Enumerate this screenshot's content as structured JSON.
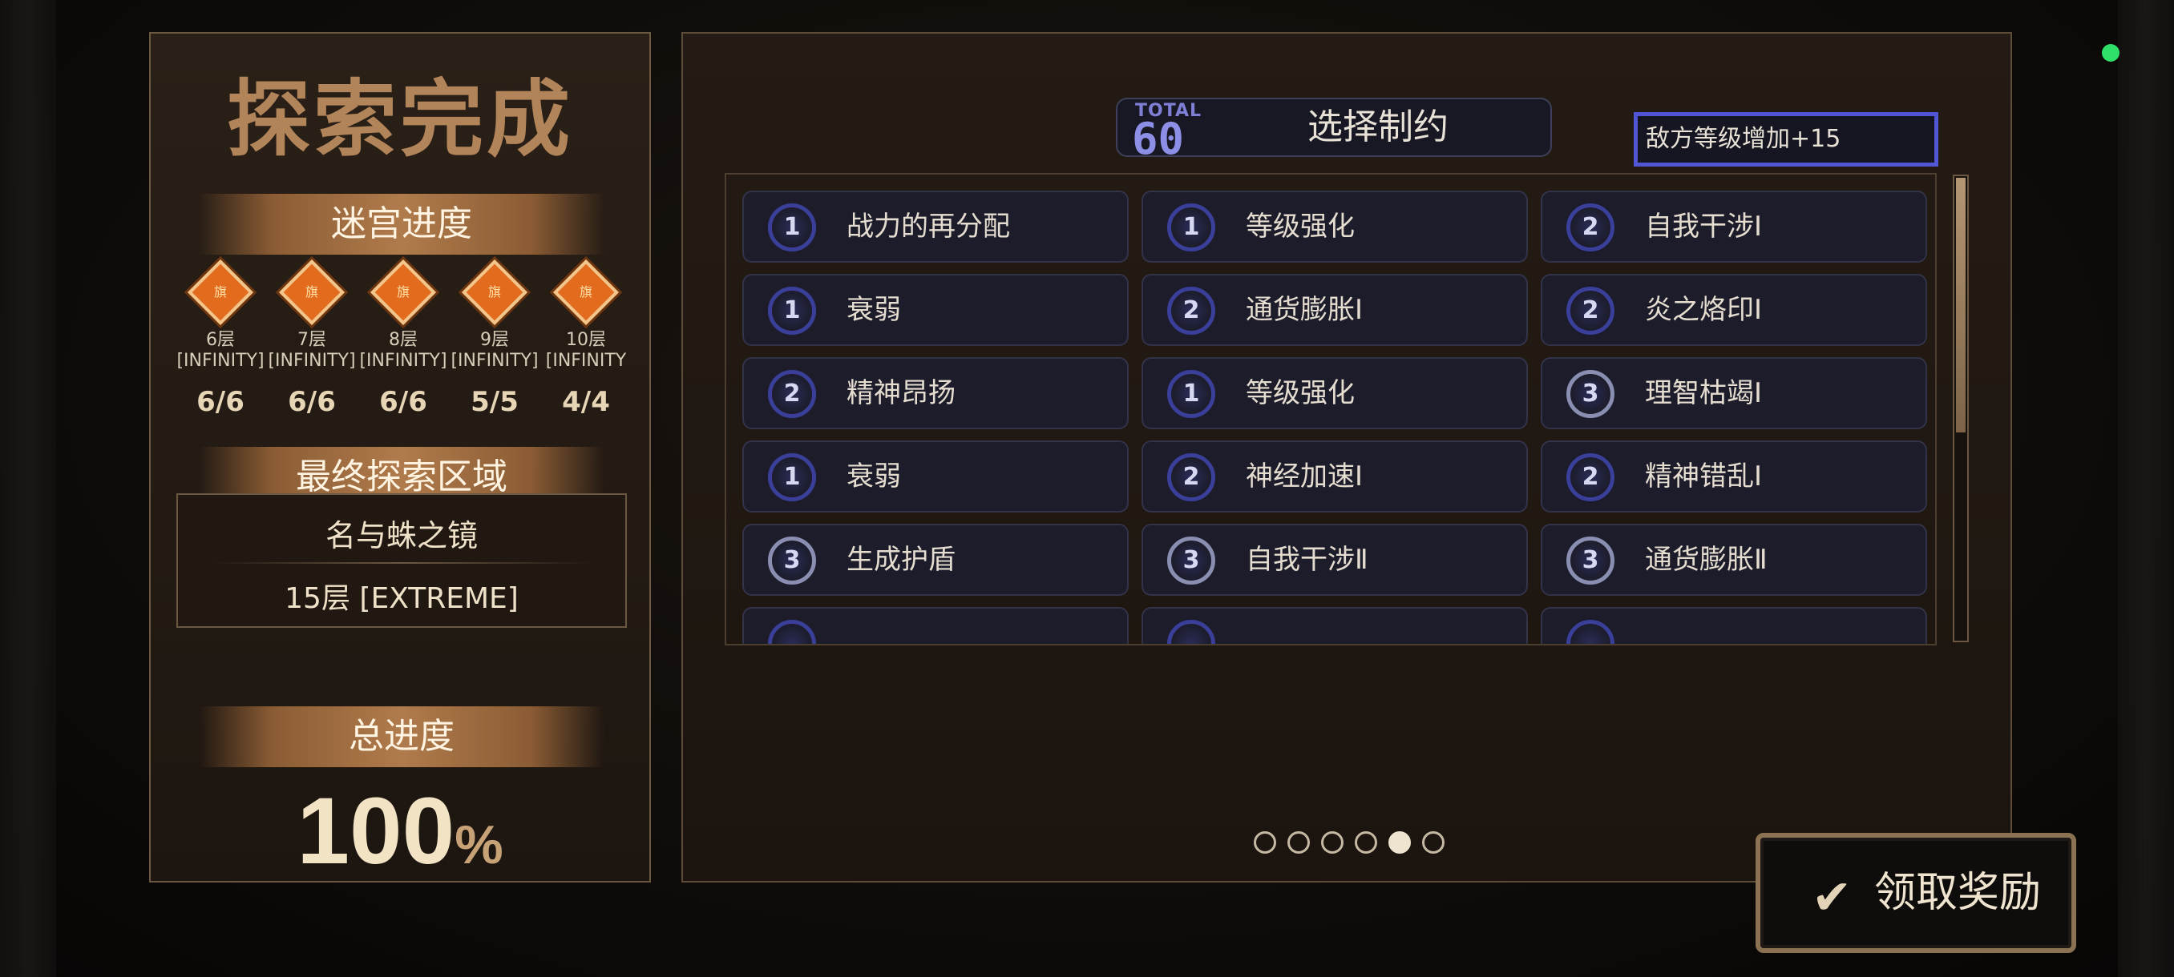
{
  "left_panel": {
    "title": "探索完成",
    "maze_progress_label": "迷宫进度",
    "floors": [
      {
        "name": "6层",
        "difficulty": "[INFINITY]",
        "emblem": "旗",
        "count": "6/6"
      },
      {
        "name": "7层",
        "difficulty": "[INFINITY]",
        "emblem": "旗",
        "count": "6/6"
      },
      {
        "name": "8层",
        "difficulty": "[INFINITY]",
        "emblem": "旗",
        "count": "6/6"
      },
      {
        "name": "9层",
        "difficulty": "[INFINITY]",
        "emblem": "旗",
        "count": "5/5"
      },
      {
        "name": "10层",
        "difficulty": "[INFINITY",
        "emblem": "旗",
        "count": "4/4"
      }
    ],
    "final_area_label": "最终探索区域",
    "final_area_name": "名与蛛之镜",
    "final_area_floor": "15层 [EXTREME]",
    "total_progress_label": "总进度",
    "total_progress_value": "100",
    "total_progress_unit": "%"
  },
  "right_panel": {
    "total_label": "TOTAL",
    "total_value": "60",
    "select_title": "选择制约",
    "tooltip": "敌方等级增加+15",
    "constraints": [
      {
        "level": "1",
        "name": "战力的再分配"
      },
      {
        "level": "1",
        "name": "等级强化"
      },
      {
        "level": "2",
        "name": "自我干涉Ⅰ"
      },
      {
        "level": "1",
        "name": "衰弱"
      },
      {
        "level": "2",
        "name": "通货膨胀Ⅰ"
      },
      {
        "level": "2",
        "name": "炎之烙印Ⅰ"
      },
      {
        "level": "2",
        "name": "精神昂扬"
      },
      {
        "level": "1",
        "name": "等级强化"
      },
      {
        "level": "3",
        "name": "理智枯竭Ⅰ"
      },
      {
        "level": "1",
        "name": "衰弱"
      },
      {
        "level": "2",
        "name": "神经加速Ⅰ"
      },
      {
        "level": "2",
        "name": "精神错乱Ⅰ"
      },
      {
        "level": "3",
        "name": "生成护盾"
      },
      {
        "level": "3",
        "name": "自我干涉Ⅱ"
      },
      {
        "level": "3",
        "name": "通货膨胀Ⅱ"
      }
    ],
    "pager": {
      "pages": 6,
      "active": 5
    }
  },
  "claim_button": {
    "label": "领取奖励",
    "icon": "check-icon"
  },
  "colors": {
    "accent": "#5156d6",
    "banner": "#b07b4c",
    "status_dot": "#2ee06a"
  }
}
